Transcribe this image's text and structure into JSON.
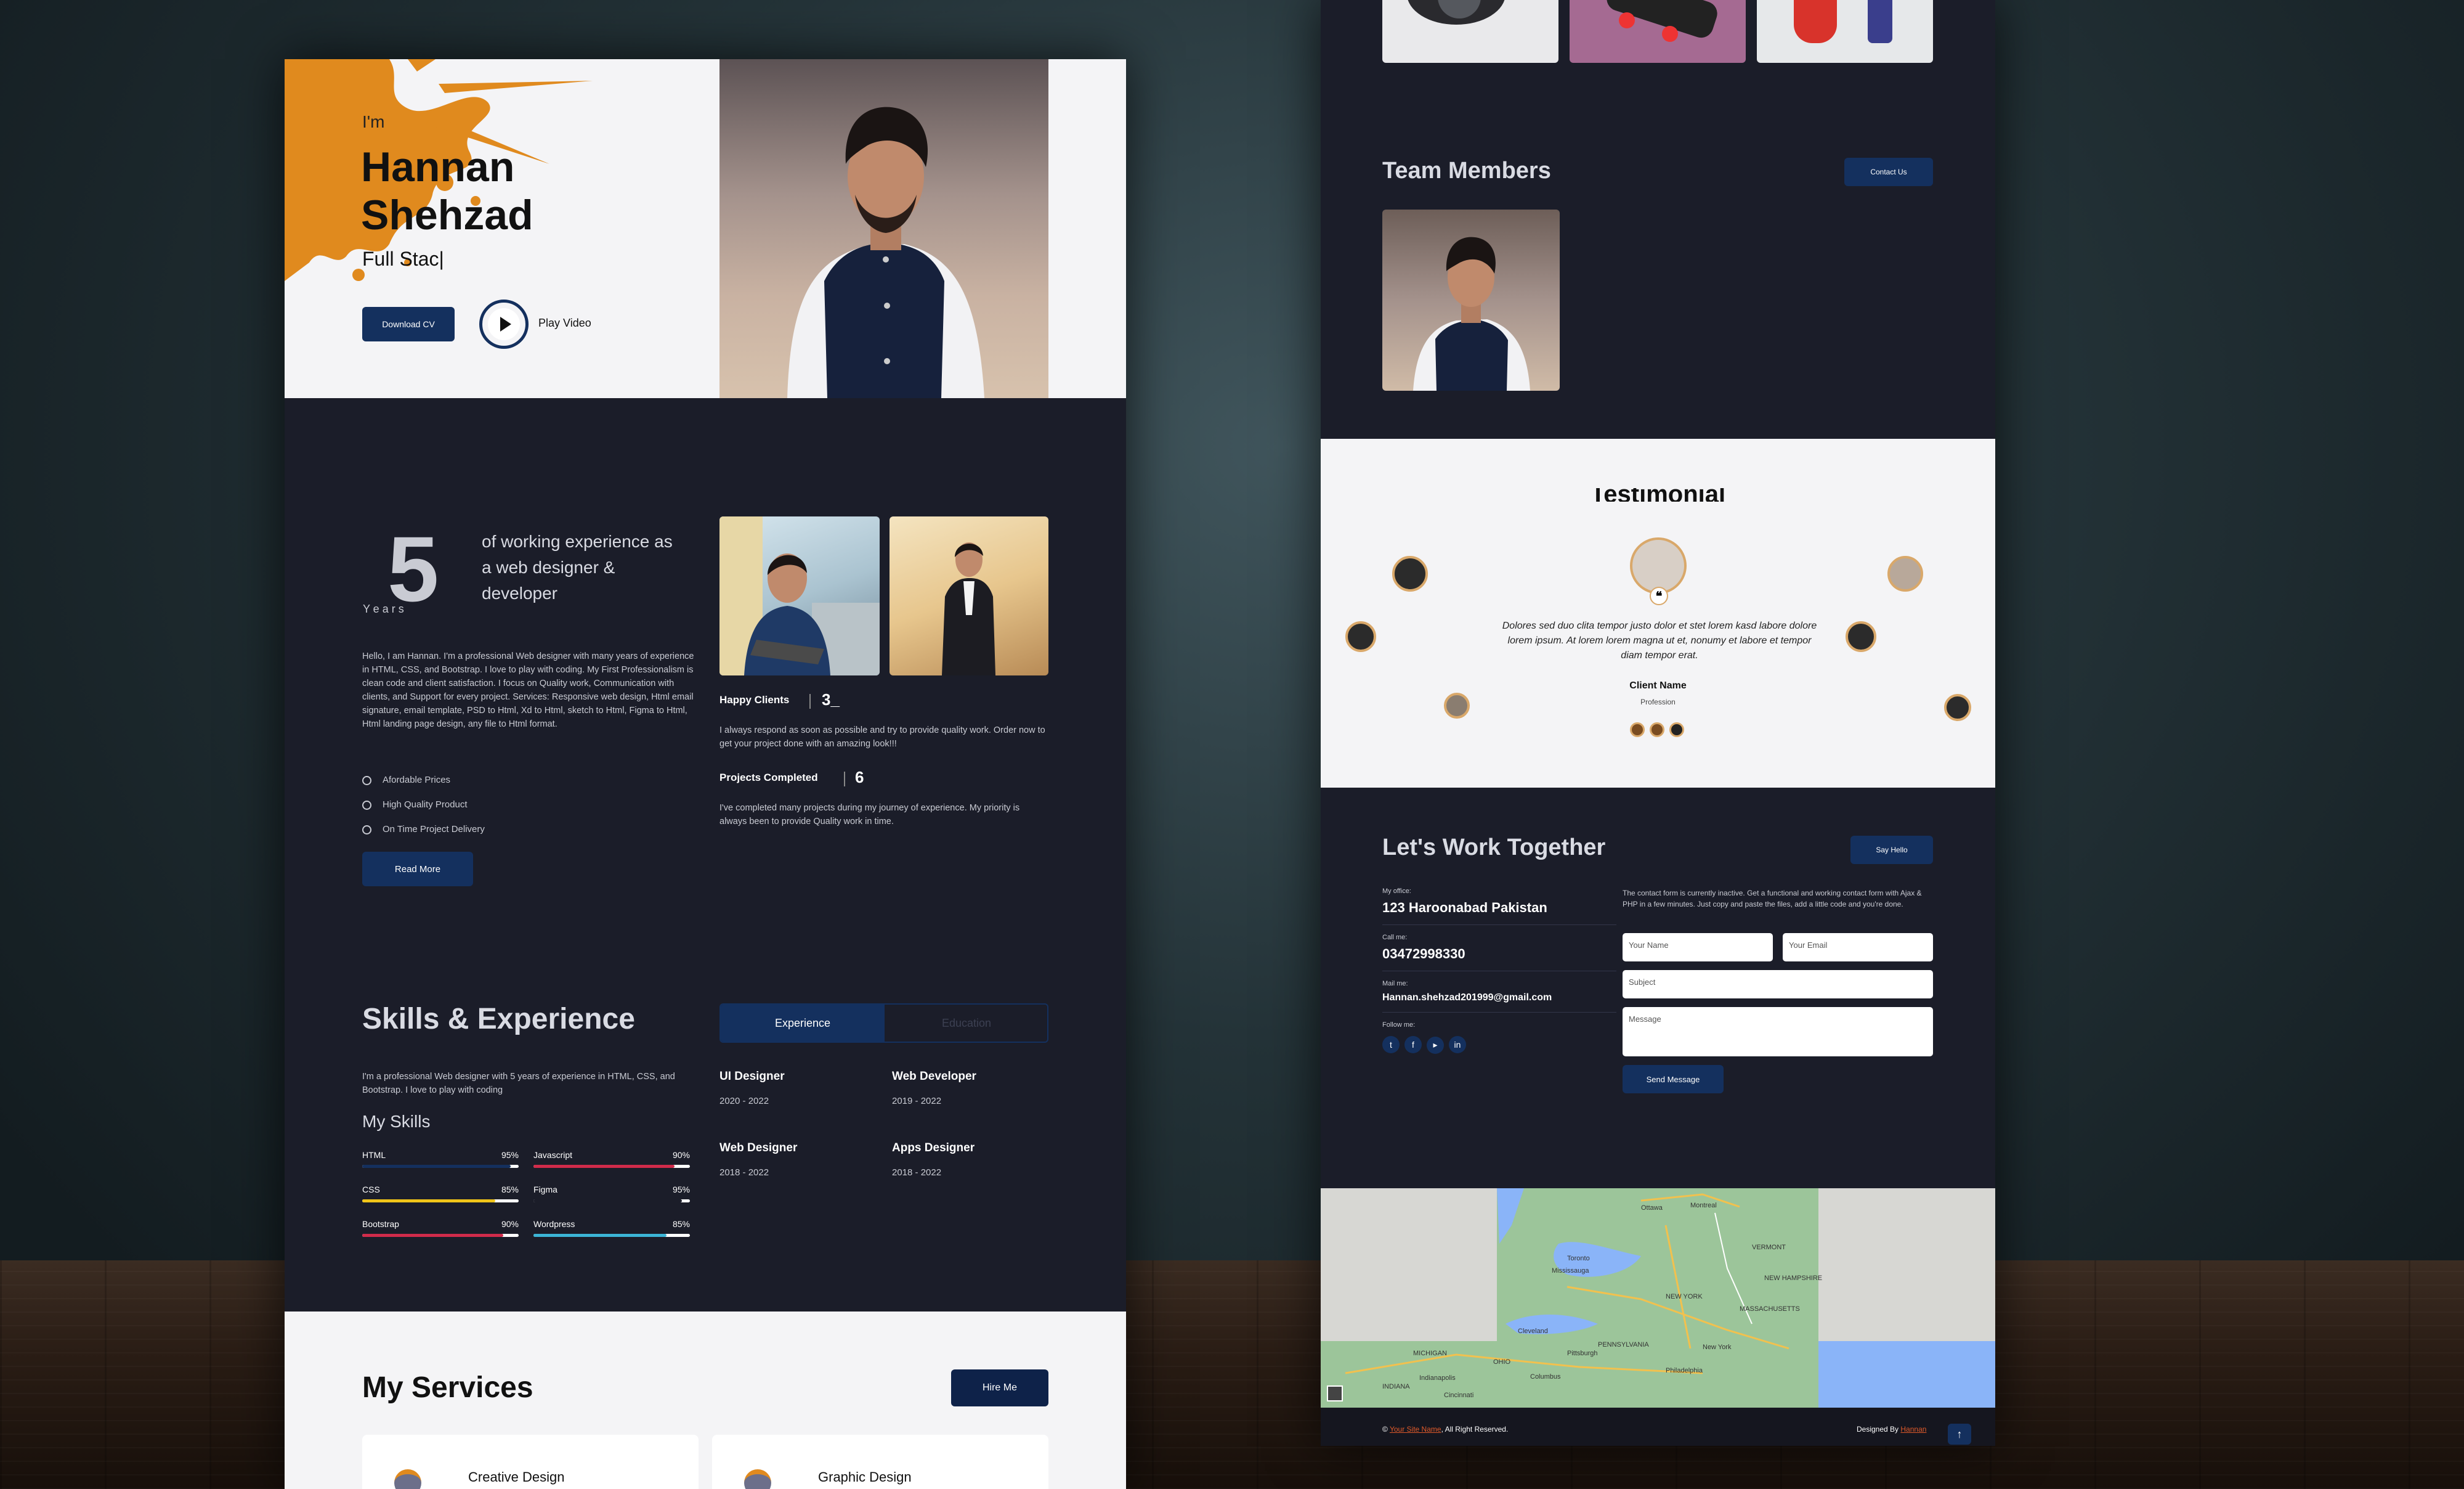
{
  "hero": {
    "greeting": "I'm",
    "first_name": "Hannan",
    "last_name": "Shehzad",
    "typed_role": "Full Stac|",
    "download_cv": "Download CV",
    "play_video": "Play Video"
  },
  "about": {
    "years_number": "5",
    "years_label": "Y e a r s",
    "experience_heading": "of working experience as a web designer & developer",
    "bio": "Hello, I am Hannan. I'm a professional Web designer with many years of experience in HTML, CSS, and Bootstrap. I love to play with coding. My First Professionalism is clean code and client satisfaction. I focus on Quality work, Communication with clients, and Support for every project. Services: Responsive web design, Html email signature, email template, PSD to Html, Xd to Html, sketch to Html, Figma to Html, Html landing page design, any file to Html format.",
    "features": [
      "Afordable Prices",
      "High Quality Product",
      "On Time Project Delivery"
    ],
    "read_more": "Read More",
    "happy_clients_label": "Happy Clients",
    "happy_clients_value": "3_",
    "happy_clients_text": "I always respond as soon as possible and try to provide quality work. Order now to get your project done with an amazing look!!!",
    "projects_label": "Projects Completed",
    "projects_value": "6",
    "projects_text": "I've completed many projects during my journey of experience. My priority is always been to provide Quality work in time."
  },
  "skills": {
    "title": "Skills & Experience",
    "intro": "I'm a professional Web designer with 5 years of experience in HTML, CSS, and Bootstrap. I love to play with coding",
    "my_skills": "My Skills",
    "items": [
      {
        "name": "HTML",
        "pct": "95%",
        "value": 95,
        "color": "#14305e"
      },
      {
        "name": "Javascript",
        "pct": "90%",
        "value": 90,
        "color": "#d12b4a"
      },
      {
        "name": "CSS",
        "pct": "85%",
        "value": 85,
        "color": "#f0c419"
      },
      {
        "name": "Figma",
        "pct": "95%",
        "value": 95,
        "color": "#1b1d29"
      },
      {
        "name": "Bootstrap",
        "pct": "90%",
        "value": 90,
        "color": "#d12b4a"
      },
      {
        "name": "Wordpress",
        "pct": "85%",
        "value": 85,
        "color": "#3bb5d6"
      }
    ],
    "tabs": [
      "Experience",
      "Education"
    ],
    "experience": [
      {
        "role": "UI Designer",
        "years": "2020 - 2022"
      },
      {
        "role": "Web Developer",
        "years": "2019 - 2022"
      },
      {
        "role": "Web Designer",
        "years": "2018 - 2022"
      },
      {
        "role": "Apps Designer",
        "years": "2018 - 2022"
      }
    ]
  },
  "services": {
    "title": "My Services",
    "hire_me": "Hire Me",
    "cards": [
      "Creative Design",
      "Graphic Design"
    ]
  },
  "team": {
    "title": "Team Members",
    "contact_us": "Contact Us"
  },
  "testimonial": {
    "title": "Testimonial",
    "quote": "Dolores sed duo clita tempor justo dolor et stet lorem kasd labore dolore lorem ipsum. At lorem lorem magna ut et, nonumy et labore et tempor diam tempor erat.",
    "client_name": "Client Name",
    "profession": "Profession"
  },
  "contact": {
    "title": "Let's Work Together",
    "say_hello": "Say Hello",
    "office_label": "My office:",
    "office": "123 Haroonabad Pakistan",
    "call_label": "Call me:",
    "phone": "03472998330",
    "mail_label": "Mail me:",
    "email": "Hannan.shehzad201999@gmail.com",
    "follow_label": "Follow me:",
    "form_note": "The contact form is currently inactive. Get a functional and working contact form with Ajax & PHP in a few minutes. Just copy and paste the files, add a little code and you're done.",
    "ph_name": "Your Name",
    "ph_email": "Your Email",
    "ph_subject": "Subject",
    "ph_message": "Message",
    "send": "Send Message"
  },
  "map": {
    "labels": [
      "Ottawa",
      "Montreal",
      "VERMONT",
      "Toronto",
      "Mississauga",
      "NEW HAMPSHIRE",
      "MASSACHUSETTS",
      "Cleveland",
      "NEW YORK",
      "PENNSYLVANIA",
      "New York",
      "Philadelphia",
      "Pittsburgh",
      "Columbus",
      "Indianapolis",
      "Cincinnati",
      "INDIANA",
      "OHIO",
      "MICHIGAN"
    ]
  },
  "footer": {
    "copy_symbol": "©",
    "site_name": "Your Site Name",
    "rights": ", All Right Reserved.",
    "designed_by": "Designed By",
    "designer": "Hannan",
    "up_arrow": "↑"
  },
  "colors": {
    "navy": "#14305e",
    "dark": "#1b1d29",
    "light": "#f4f4f6",
    "accent": "#e08a1e"
  },
  "icons": [
    "play-icon",
    "check-circle-icon",
    "twitter-icon",
    "facebook-icon",
    "youtube-icon",
    "linkedin-icon",
    "quote-icon",
    "arrow-up-icon"
  ]
}
